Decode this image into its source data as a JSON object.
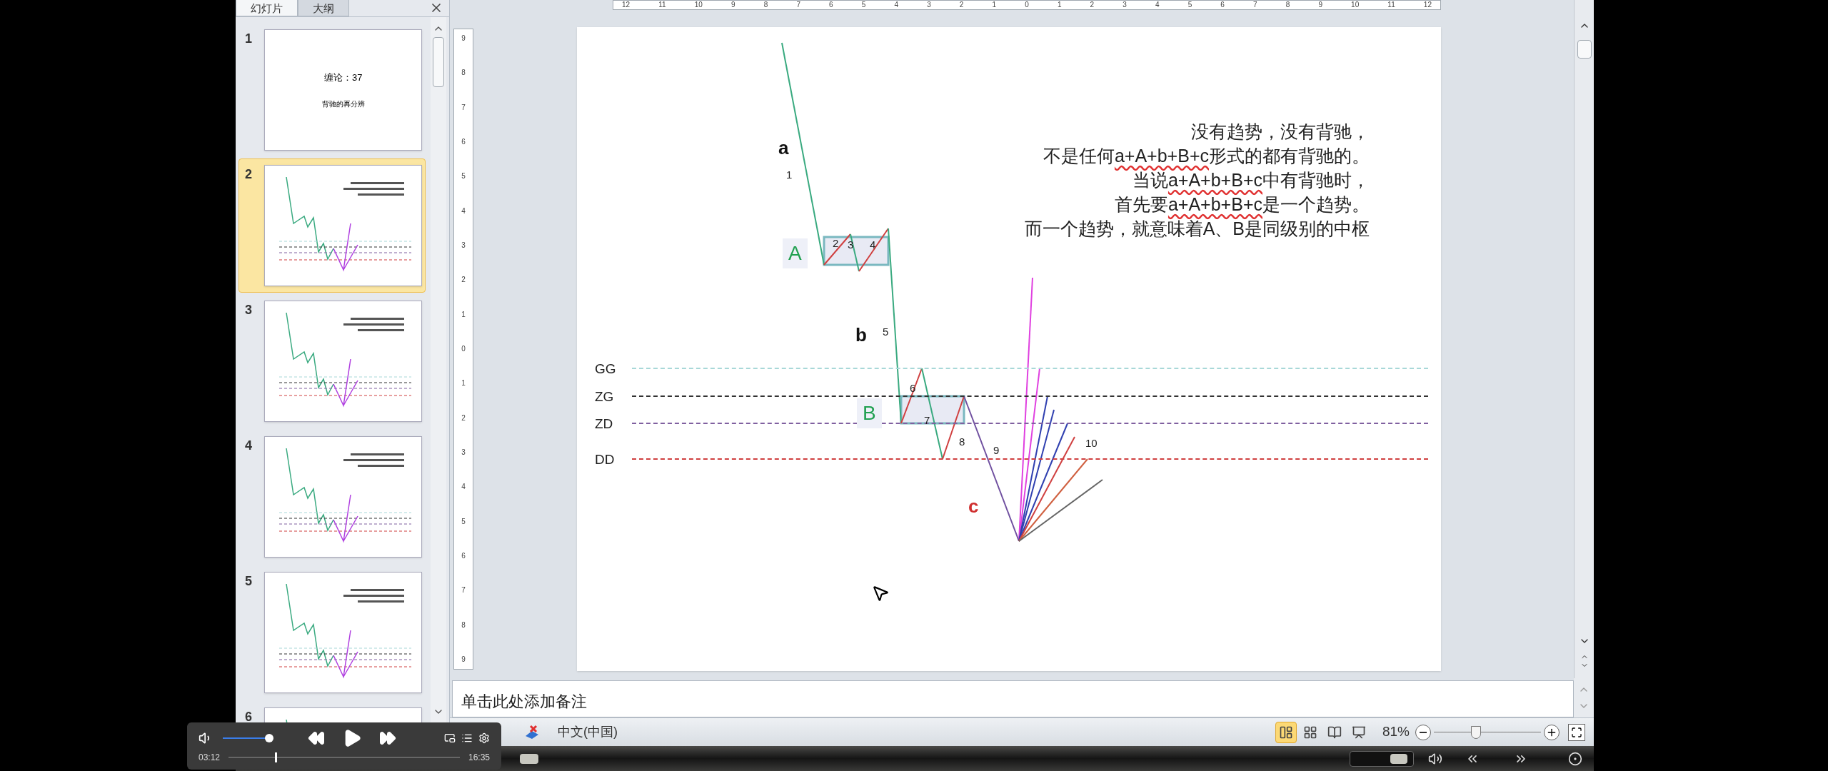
{
  "panel_tabs": [
    {
      "label": "幻灯片",
      "selected": true
    },
    {
      "label": "大纲",
      "selected": false
    }
  ],
  "thumbnails": [
    {
      "number": "1",
      "selected": false,
      "title": "缠论：37",
      "subtitle": "背驰的再分辨"
    },
    {
      "number": "2",
      "selected": true
    },
    {
      "number": "3",
      "selected": false
    },
    {
      "number": "4",
      "selected": false
    },
    {
      "number": "5",
      "selected": false
    },
    {
      "number": "6",
      "selected": false
    }
  ],
  "horizontal_ruler": [
    "12",
    "11",
    "10",
    "9",
    "8",
    "7",
    "6",
    "5",
    "4",
    "3",
    "2",
    "1",
    "0",
    "1",
    "2",
    "3",
    "4",
    "5",
    "6",
    "7",
    "8",
    "9",
    "10",
    "11",
    "12"
  ],
  "vertical_ruler": [
    "9",
    "8",
    "7",
    "6",
    "5",
    "4",
    "3",
    "2",
    "1",
    "0",
    "1",
    "2",
    "3",
    "4",
    "5",
    "6",
    "7",
    "8",
    "9"
  ],
  "slide": {
    "text_lines": [
      [
        {
          "text": "没有趋势，没有背驰，",
          "misspelled": false
        }
      ],
      [
        {
          "text": "不是任何",
          "misspelled": false
        },
        {
          "text": "a+A+b+B+c",
          "misspelled": true
        },
        {
          "text": "形式的都有背驰的。",
          "misspelled": false
        }
      ],
      [
        {
          "text": "当说",
          "misspelled": false
        },
        {
          "text": "a+A+b+B+c",
          "misspelled": true
        },
        {
          "text": "中有背驰时，",
          "misspelled": false
        }
      ],
      [
        {
          "text": "首先要",
          "misspelled": false
        },
        {
          "text": "a+A+b+B+c",
          "misspelled": true
        },
        {
          "text": "是一个趋势。",
          "misspelled": false
        }
      ],
      [
        {
          "text": "而一个趋势，就意味着A、B是同级别的中枢",
          "misspelled": false
        }
      ]
    ],
    "diagram": {
      "segment_labels": [
        {
          "text": "a",
          "color": "#111111"
        },
        {
          "text": "b",
          "color": "#111111"
        },
        {
          "text": "c",
          "color": "#d03030"
        }
      ],
      "centers": [
        {
          "text": "A"
        },
        {
          "text": "B"
        }
      ],
      "stroke_numbers": [
        "1",
        "2",
        "3",
        "4",
        "5",
        "6",
        "7",
        "8",
        "9",
        "10"
      ],
      "levels": [
        {
          "name": "GG",
          "color": "#a8d8d8"
        },
        {
          "name": "ZG",
          "color": "#333333"
        },
        {
          "name": "ZD",
          "color": "#8060a0"
        },
        {
          "name": "DD",
          "color": "#d04040"
        }
      ]
    }
  },
  "notes_placeholder": "单击此处添加备注",
  "status_bar": {
    "language": "中文(中国)",
    "views": [
      {
        "kind": "normal",
        "selected": true
      },
      {
        "kind": "sorter",
        "selected": false
      },
      {
        "kind": "reading",
        "selected": false
      },
      {
        "kind": "slideshow",
        "selected": false
      }
    ],
    "zoom": "81%",
    "zoom_slider": {
      "level": 0.38
    }
  },
  "player": {
    "volume": {
      "level": 1
    },
    "elapsed": "03:12",
    "duration": "16:35",
    "progress": {
      "level": 0.2
    }
  }
}
